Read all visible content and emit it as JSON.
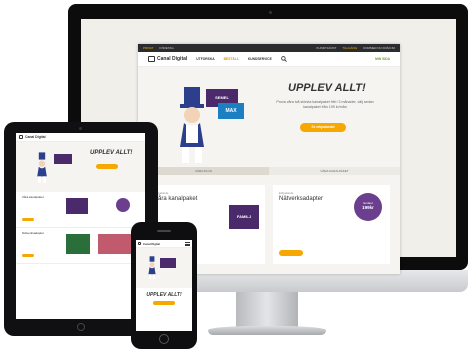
{
  "desktop": {
    "util_bar": {
      "left_items": [
        "PRIVAT",
        "FÖRETAG"
      ],
      "right_items": [
        "KUNDTJÄNST",
        "TILLGÄNG",
        "KOMMER DU FRÅN 60"
      ]
    },
    "logo_text": "Canal Digital",
    "nav": {
      "items": [
        "UTFORSKA",
        "BESTÄLL",
        "KUNDSERVICE"
      ],
      "cta": "MIN SIDA"
    },
    "hero": {
      "title": "UPPLEV ALLT!",
      "subtitle": "Prova våra två största kanalpaket fritt i 3 månader, välj sedan kanalpaket från 199 kr/mån",
      "button": "Se erbjudandet",
      "package_labels": [
        "SEMEL",
        "MAX"
      ]
    },
    "tabs": [
      "VÅRA PLUS",
      "VÅRA KANALPAKET"
    ],
    "cards": [
      {
        "kicker": "Erbjudande",
        "title": "Våra kanalpaket",
        "package_label": "FAMILJ"
      },
      {
        "kicker": "Erbjudande",
        "title": "Nätverksadapter",
        "badge_price": "199kr",
        "badge_top": "Endast"
      }
    ]
  },
  "tablet": {
    "logo_text": "Canal Digital",
    "hero_title": "UPPLEV ALLT!",
    "section_titles": [
      "Våra kanalpaket",
      "Nätverksadapter"
    ]
  },
  "phone": {
    "logo_text": "Canal Digital",
    "hero_title": "UPPLEV ALLT!"
  },
  "colors": {
    "accent_yellow": "#f7a800",
    "brand_purple": "#6b3e8e",
    "cta_green": "#6a9d2b",
    "device_dark": "#0c0c0d"
  }
}
